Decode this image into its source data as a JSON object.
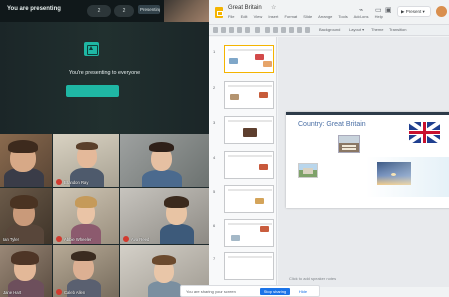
{
  "meet": {
    "presenting_label": "You are presenting",
    "present_message": "You're presenting to everyone",
    "top_pill_a": "2",
    "top_pill_b": "2",
    "top_name": "Presenting",
    "tiles": [
      {
        "name": ""
      },
      {
        "name": "Brandon Ray"
      },
      {
        "name": ""
      },
      {
        "name": "Ian Tyler"
      },
      {
        "name": "Abbie Wheeler"
      },
      {
        "name": "Ava Reed"
      },
      {
        "name": "Jane Hart"
      },
      {
        "name": "Caleb Allen"
      },
      {
        "name": ""
      }
    ]
  },
  "slides_app": {
    "title": "Great Britain",
    "star": "☆",
    "menu": [
      "File",
      "Edit",
      "View",
      "Insert",
      "Format",
      "Slide",
      "Arrange",
      "Tools",
      "Add-ons",
      "Help"
    ],
    "present_label": "▶ Present ▾",
    "toolbar_items": [
      "Background",
      "Layout ▾",
      "Theme",
      "Transition"
    ],
    "thumbnail_numbers": [
      "1",
      "2",
      "3",
      "4",
      "5",
      "6",
      "7"
    ],
    "slide": {
      "title": "Country: Great Britain"
    },
    "notes_hint": "Click to add speaker notes"
  },
  "share_bar": {
    "text": "You are sharing your screen",
    "stop_label": "Stop sharing",
    "hide_label": "Hide"
  },
  "colors": {
    "accent_teal": "#1fb7a4",
    "slides_yellow": "#f4b400",
    "button_blue": "#1a73e8"
  }
}
